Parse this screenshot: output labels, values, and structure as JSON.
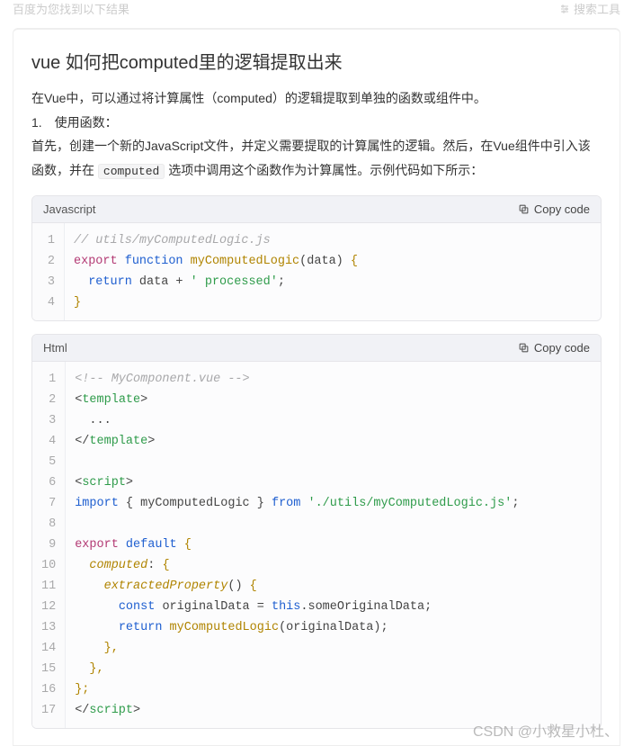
{
  "topbar": {
    "left": "百度为您找到以下结果",
    "right": "搜索工具",
    "icon_name": "sliders-icon"
  },
  "title": "vue 如何把computed里的逻辑提取出来",
  "paras": {
    "p1": "在Vue中，可以通过将计算属性（computed）的逻辑提取到单独的函数或组件中。",
    "p2": "1. 使用函数：",
    "p3_a": "首先，创建一个新的JavaScript文件，并定义需要提取的计算属性的逻辑。然后，在Vue组件中引入该函数，并在 ",
    "p3_code": "computed",
    "p3_b": " 选项中调用这个函数作为计算属性。示例代码如下所示："
  },
  "copy_label": "Copy code",
  "block1": {
    "lang": "Javascript",
    "lines": 4,
    "l1": "// utils/myComputedLogic.js",
    "l2_a": "export",
    "l2_b": "function",
    "l2_c": "myComputedLogic",
    "l2_d": "(data)",
    "l2_e": "{",
    "l3_a": "return",
    "l3_b": "data +",
    "l3_c": "' processed'",
    "l3_d": ";",
    "l4": "}"
  },
  "block2": {
    "lang": "Html",
    "lines": 17,
    "l1": "<!-- MyComponent.vue -->",
    "l2_a": "<",
    "l2_b": "template",
    "l2_c": ">",
    "l3": "...",
    "l4_a": "</",
    "l4_b": "template",
    "l4_c": ">",
    "l6_a": "<",
    "l6_b": "script",
    "l6_c": ">",
    "l7_a": "import",
    "l7_b": "{ myComputedLogic }",
    "l7_c": "from",
    "l7_d": "'./utils/myComputedLogic.js'",
    "l7_e": ";",
    "l9_a": "export",
    "l9_b": "default",
    "l9_c": "{",
    "l10_a": "computed",
    "l10_b": ":",
    "l10_c": "{",
    "l11_a": "extractedProperty",
    "l11_b": "()",
    "l11_c": "{",
    "l12_a": "const",
    "l12_b": "originalData =",
    "l12_c": "this",
    "l12_d": ".someOriginalData;",
    "l13_a": "return",
    "l13_b": "myComputedLogic",
    "l13_c": "(originalData);",
    "l14": "},",
    "l15": "},",
    "l16": "};",
    "l17_a": "</",
    "l17_b": "script",
    "l17_c": ">"
  },
  "watermark": "CSDN @小救星小杜、"
}
